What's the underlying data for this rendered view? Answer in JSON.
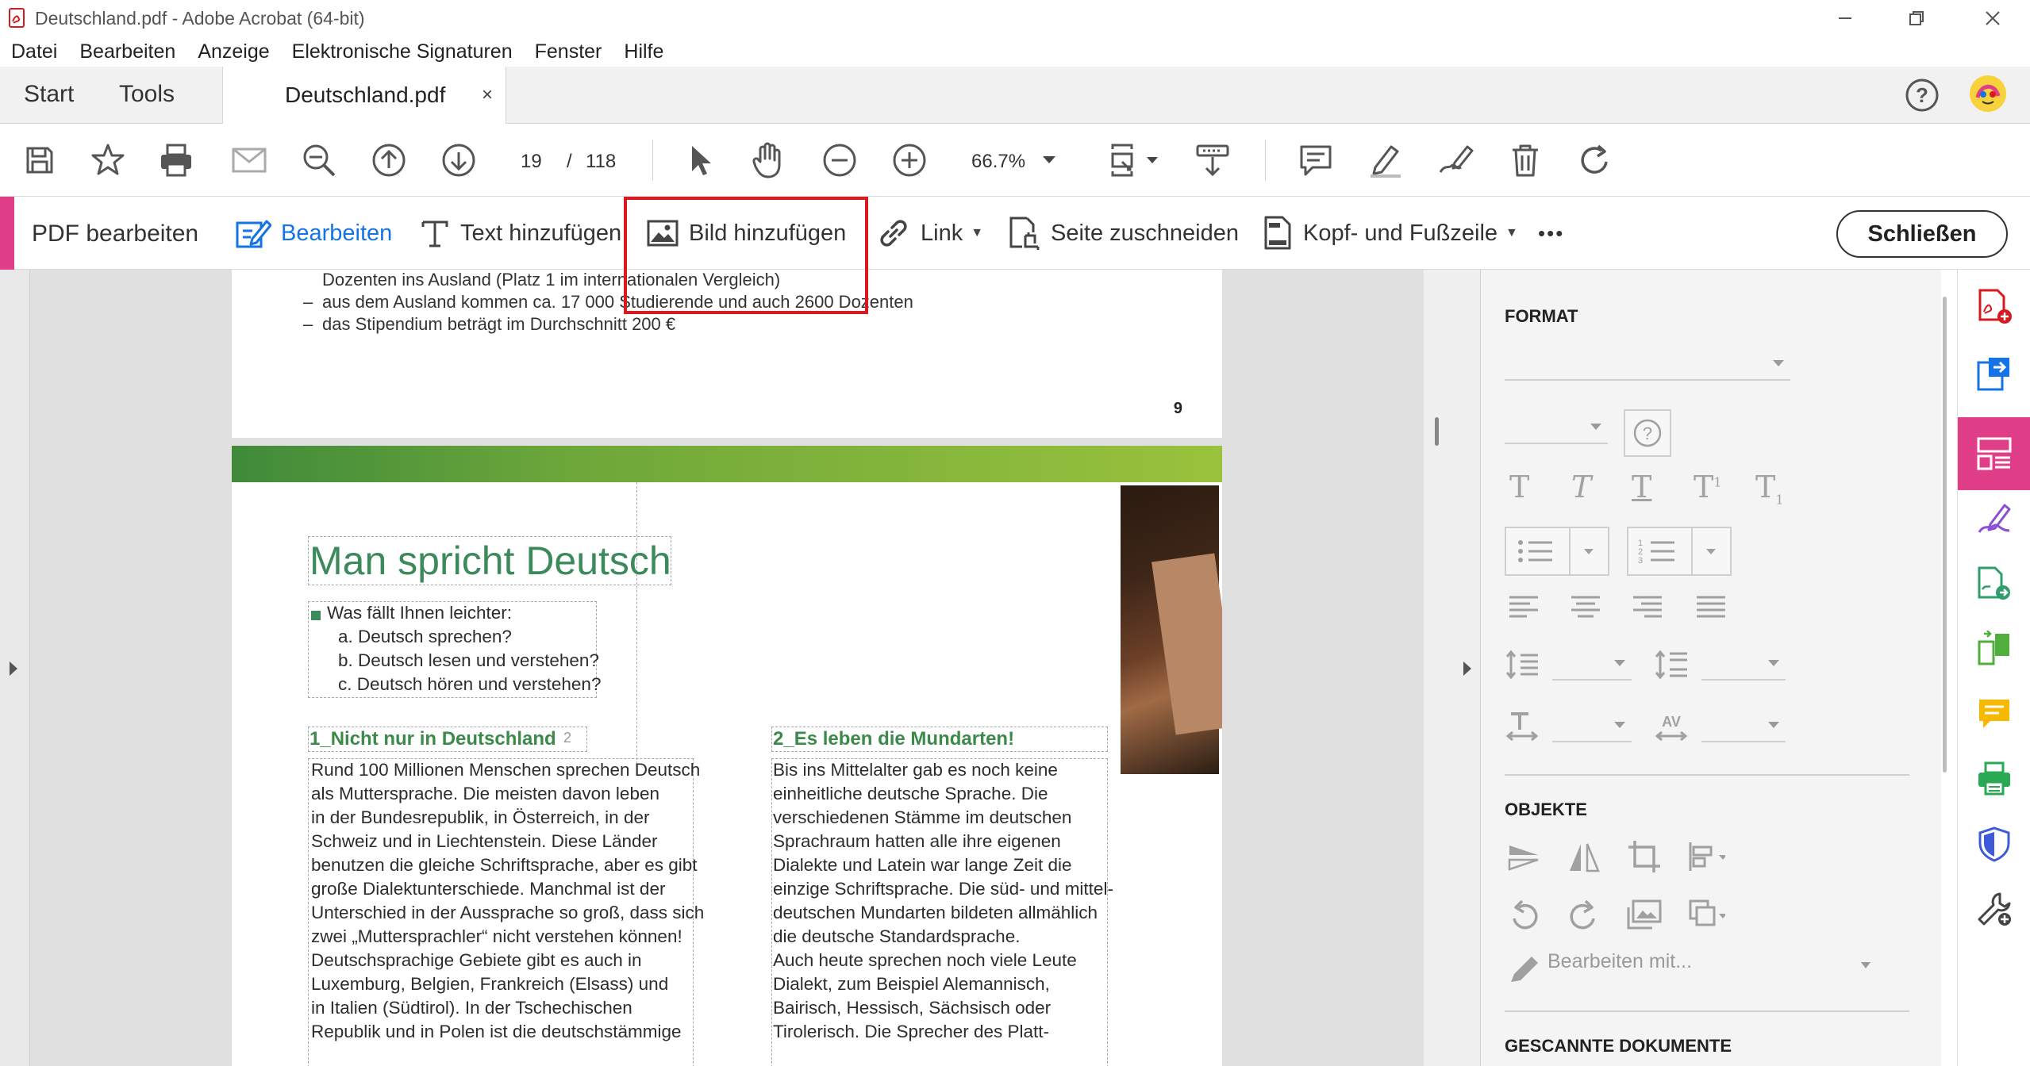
{
  "window": {
    "title": "Deutschland.pdf - Adobe Acrobat (64-bit)"
  },
  "menu": [
    "Datei",
    "Bearbeiten",
    "Anzeige",
    "Elektronische Signaturen",
    "Fenster",
    "Hilfe"
  ],
  "tabs": {
    "start": "Start",
    "tools": "Tools",
    "document": "Deutschland.pdf",
    "close": "×"
  },
  "toolbar": {
    "page_current": "19",
    "page_sep": "/",
    "page_total": "118",
    "zoom": "66.7%"
  },
  "edit_toolbar": {
    "mode": "PDF bearbeiten",
    "edit": "Bearbeiten",
    "add_text": "Text hinzufügen",
    "add_image": "Bild hinzufügen",
    "link": "Link",
    "crop": "Seite zuschneiden",
    "header_footer": "Kopf- und Fußzeile",
    "more": "•••",
    "close": "Schließen"
  },
  "document": {
    "page1_lines": [
      "Dozenten ins Ausland (Platz 1 im internationalen Vergleich)",
      "aus dem Ausland kommen ca. 17 000 Studierende und auch 2600 Dozenten",
      "das Stipendium beträgt im Durchschnitt 200 €"
    ],
    "page1_number": "9",
    "title": "Man spricht Deutsch",
    "questions": [
      "Was fällt Ihnen leichter:",
      "a.  Deutsch sprechen?",
      "b.  Deutsch lesen und verstehen?",
      "c.  Deutsch hören und verstehen?"
    ],
    "section1_heading": "1_Nicht nur in Deutschland",
    "section1_mark": "2",
    "section1_lines": [
      "Rund 100 Millionen Menschen sprechen Deutsch",
      "als Muttersprache. Die meisten davon leben",
      "in der Bundesrepublik, in Österreich, in der",
      "Schweiz und in Liechtenstein. Diese Länder",
      "benutzen die gleiche Schriftsprache, aber es gibt",
      "große Dialektunterschiede. Manchmal ist der",
      "Unterschied in der Aussprache so groß, dass sich",
      "zwei „Muttersprachler“ nicht verstehen können!",
      "Deutschsprachige Gebiete gibt es auch in",
      "Luxemburg, Belgien, Frankreich (Elsass) und",
      "in Italien (Südtirol). In der Tschechischen",
      "Republik und in Polen ist die deutschstämmige"
    ],
    "section2_heading": "2_Es leben die Mundarten!",
    "section2_lines": [
      "Bis ins Mittelalter gab es noch keine",
      "einheitliche deutsche Sprache. Die",
      "verschiedenen Stämme im deutschen",
      "Sprachraum hatten alle ihre eigenen",
      "Dialekte und Latein war lange Zeit die",
      "einzige Schriftsprache. Die süd- und mittel-",
      "deutschen Mundarten bildeten allmählich",
      "die deutsche Standardsprache.",
      "Auch heute sprechen noch viele Leute",
      "Dialekt, zum Beispiel Alemannisch,",
      "Bairisch, Hessisch, Sächsisch oder",
      "Tirolerisch. Die Sprecher des Platt-"
    ]
  },
  "right_panel": {
    "format_heading": "FORMAT",
    "objects_heading": "OBJEKTE",
    "edit_with": "Bearbeiten mit...",
    "scanned_heading": "GESCANNTE DOKUMENTE"
  },
  "colors": {
    "accent": "#e13e8a",
    "active_blue": "#1473e6",
    "highlight_red": "#d71920",
    "doc_green": "#3c8a5c"
  }
}
